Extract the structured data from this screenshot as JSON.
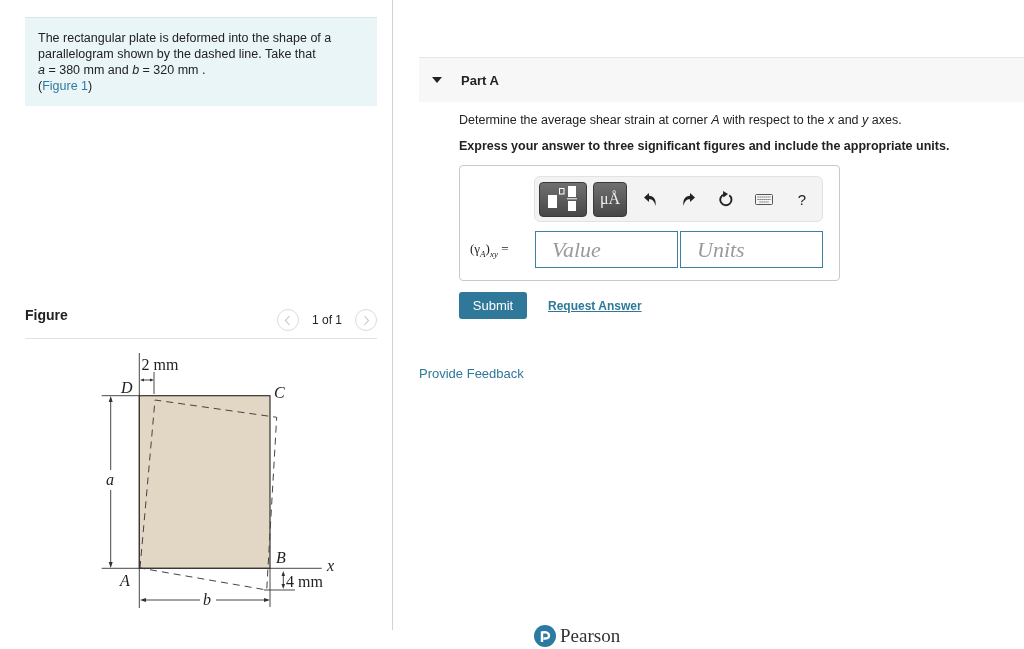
{
  "problem": {
    "lines": [
      "The rectangular plate is deformed into the shape of a",
      "parallelogram shown by the dashed line. Take that",
      "*a* = 380 mm and *b* = 320 mm ."
    ],
    "link_prefix": "(",
    "link": "Figure 1",
    "link_suffix": ")"
  },
  "figure": {
    "title": "Figure",
    "pager": {
      "previous": {
        "disabled": true
      },
      "label": "1 of 1",
      "next": {
        "disabled": true
      }
    },
    "diagram": {
      "offset_top": "2 mm",
      "corners": [
        "D",
        "C",
        "B",
        "A"
      ],
      "height_label": "a",
      "axis_label": "x",
      "offset_bottom": "4 mm",
      "width_label": "b"
    }
  },
  "part": {
    "title": "Part A",
    "expanded": true,
    "question": "Determine the average shear strain at corner *A* with respect to the *x* and *y* axes.",
    "instruction": "Express your answer to three significant figures and include the appropriate units.",
    "toolbar": [
      {
        "kind": "templates"
      },
      {
        "kind": "units",
        "label": "μÅ"
      },
      {
        "kind": "undo"
      },
      {
        "kind": "redo"
      },
      {
        "kind": "reset"
      },
      {
        "kind": "keyboard"
      },
      {
        "kind": "help",
        "label": "?"
      }
    ],
    "answer": {
      "label": "(γ$_{A}$)$_{xy}$ =",
      "fields": [
        {
          "placeholder": "Value"
        },
        {
          "placeholder": "Units"
        }
      ]
    },
    "submit": "Submit",
    "request": "Request Answer"
  },
  "feedback": "Provide Feedback",
  "footer": {
    "brand": "Pearson"
  }
}
